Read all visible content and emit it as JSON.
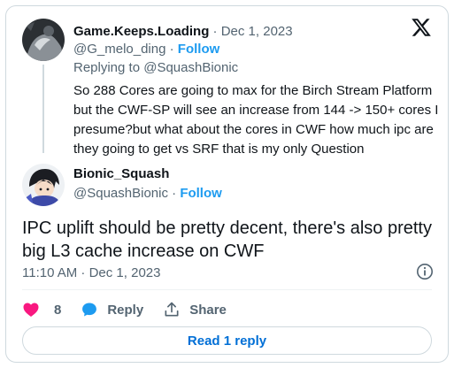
{
  "parent_tweet": {
    "display_name": "Game.Keeps.Loading",
    "separator": "·",
    "date": "Dec 1, 2023",
    "handle": "@G_melo_ding",
    "follow_label": "Follow",
    "replying_to": "Replying to @SquashBionic",
    "text": "So  288 Cores are going to max for the Birch Stream Platform\nbut the CWF-SP will see an increase from 144 ->  150+ cores I\npresume?but  what about the cores in CWF how much ipc are\nthey going to get vs SRF that is my only Question"
  },
  "main_tweet": {
    "display_name": "Bionic_Squash",
    "handle": "@SquashBionic",
    "separator": "·",
    "follow_label": "Follow",
    "text": "IPC uplift should be pretty decent, there's also pretty big L3 cache increase on CWF",
    "timestamp": "11:10 AM · Dec 1, 2023"
  },
  "actions": {
    "like_count": "8",
    "reply_label": "Reply",
    "share_label": "Share"
  },
  "read_replies_label": "Read 1 reply",
  "colors": {
    "accent_blue": "#1d9bf0",
    "link_blue": "#006fd6",
    "like_pink": "#f91880",
    "muted_text": "#536471",
    "border": "#cfd9de"
  },
  "icons": {
    "logo": "x-logo-icon",
    "info": "info-icon",
    "like": "heart-icon",
    "reply": "speech-bubble-icon",
    "share": "share-upload-icon"
  }
}
